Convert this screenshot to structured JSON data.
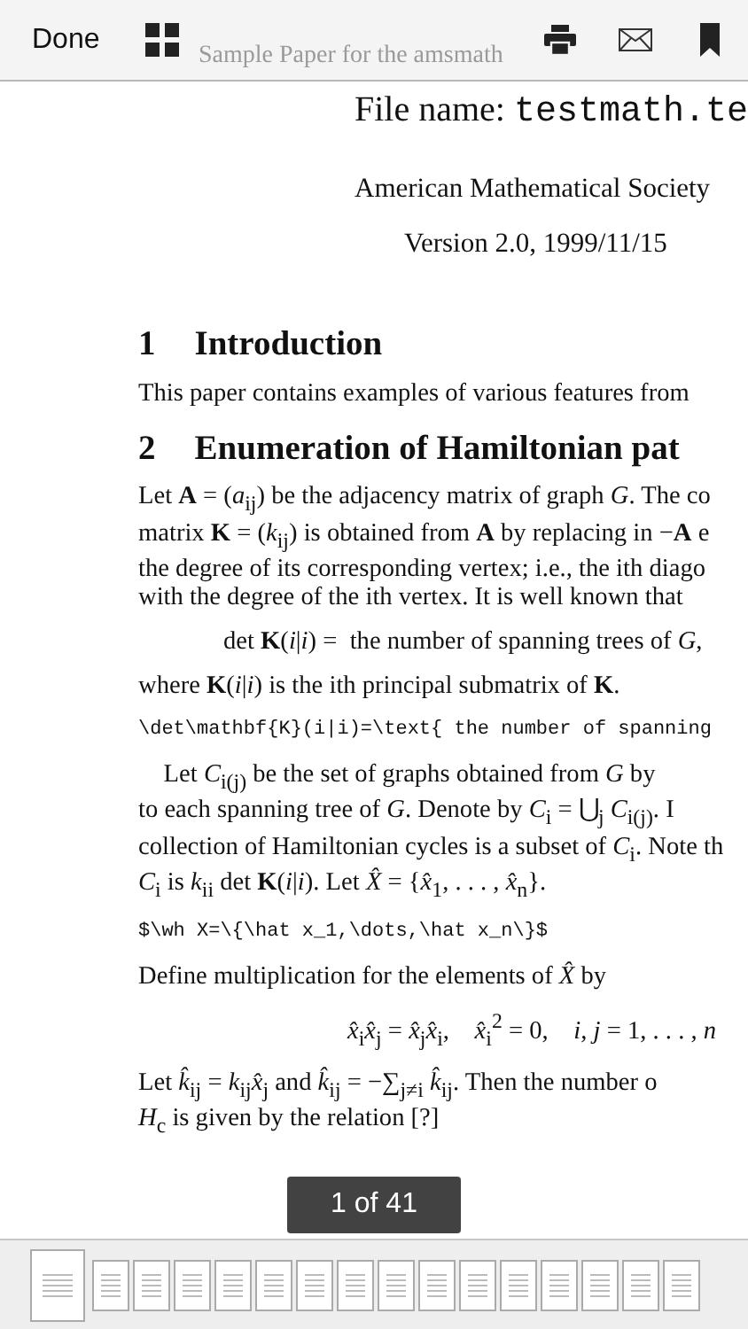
{
  "toolbar": {
    "done": "Done",
    "document_title": "Sample Paper for the amsmath"
  },
  "document": {
    "file_name_label": "File name:",
    "file_name": "testmath.te",
    "author": "American Mathematical Society",
    "version": "Version 2.0, 1999/11/15",
    "blocks": [
      {
        "kind": "heading",
        "number": "1",
        "title": "Introduction"
      },
      {
        "kind": "para",
        "lines": [
          "This paper contains examples of various features from"
        ]
      },
      {
        "kind": "heading",
        "number": "2",
        "title": "Enumeration of Hamiltonian pat"
      },
      {
        "kind": "para",
        "lines": [
          "Let **A** = (*a*$_{ij}$) be the adjacency matrix of graph *G*. The co",
          "matrix **K** = (*k*$_{ij}$) is obtained from **A** by replacing in −**A** e",
          "the degree of its corresponding vertex; i.e., the ith diago",
          "with the degree of the ith vertex. It is well known that"
        ]
      },
      {
        "kind": "display",
        "lines": [
          "det **K**(*i*|*i*) =  the number of spanning trees of *G*,"
        ]
      },
      {
        "kind": "para",
        "lines": [
          "where **K**(*i*|*i*) is the ith principal submatrix of **K**."
        ]
      },
      {
        "kind": "code",
        "lines": [
          "\\det\\mathbf{K}(i|i)=\\text{ the number of spanning"
        ]
      },
      {
        "kind": "para",
        "lines": [
          "    Let *C*$_{i(j)}$ be the set of graphs obtained from *G* by",
          "to each spanning tree of *G*. Denote by *C*$_{i}$ = ⋃$_{j}$ *C*$_{i(j)}$. I",
          "collection of Hamiltonian cycles is a subset of *C*$_{i}$. Note th",
          "*C*$_{i}$ is *k*$_{ii}$ det **K**(*i*|*i*). Let *X̂* = {*x̂*$_{1}$, . . . , *x̂*$_{n}$}."
        ]
      },
      {
        "kind": "code",
        "lines": [
          "$\\wh X=\\{\\hat x_1,\\dots,\\hat x_n\\}$"
        ]
      },
      {
        "kind": "para",
        "lines": [
          "Define multiplication for the elements of *X̂* by"
        ]
      },
      {
        "kind": "display_right",
        "lines": [
          "*x̂*$_{i}$*x̂*$_{j}$ = *x̂*$_{j}$*x̂*$_{i}$,    *x̂*$_{i}$$^{2}$ = 0,    *i*, *j* = 1, . . . , *n*"
        ]
      },
      {
        "kind": "para",
        "lines": [
          "Let *k̂*$_{ij}$ = *k*$_{ij}$*x̂*$_{j}$ and *k̂*$_{ij}$ = −∑$_{j≠i}$ *k̂*$_{ij}$. Then the number o",
          "*H*$_{c}$ is given by the relation [?]"
        ]
      }
    ]
  },
  "page_indicator": "1 of 41",
  "thumbnails": [
    {
      "selected": true
    },
    {
      "selected": false
    },
    {
      "selected": false
    },
    {
      "selected": false
    },
    {
      "selected": false
    },
    {
      "selected": false
    },
    {
      "selected": false
    },
    {
      "selected": false
    },
    {
      "selected": false
    },
    {
      "selected": false
    },
    {
      "selected": false
    },
    {
      "selected": false
    },
    {
      "selected": false
    },
    {
      "selected": false
    },
    {
      "selected": false
    },
    {
      "selected": false
    }
  ]
}
